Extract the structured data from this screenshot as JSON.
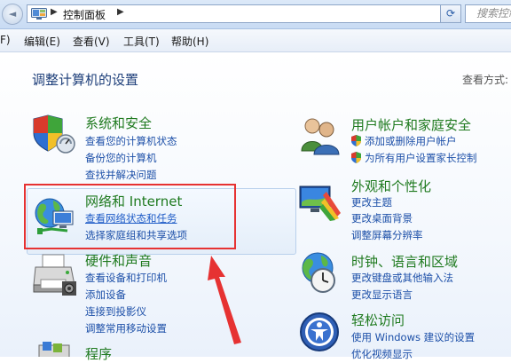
{
  "address_bar": {
    "back_glyph": "◄",
    "arrow_glyph": "▶",
    "crumb": "控制面板",
    "dropdown_glyph": "▾",
    "refresh_glyph": "⟳",
    "search_placeholder": "搜索控制面板"
  },
  "menu": {
    "items": [
      {
        "label": "F)"
      },
      {
        "label": "编辑(E)"
      },
      {
        "label": "查看(V)"
      },
      {
        "label": "工具(T)"
      },
      {
        "label": "帮助(H)"
      }
    ]
  },
  "main": {
    "title": "调整计算机的设置",
    "view_by_label": "查看方式:",
    "left_categories": [
      {
        "title": "系统和安全",
        "icon": "shield-icon",
        "links": [
          "查看您的计算机状态",
          "备份您的计算机",
          "查找并解决问题"
        ]
      },
      {
        "title": "网络和 Internet",
        "icon": "network-icon",
        "links": [
          "查看网络状态和任务",
          "选择家庭组和共享选项"
        ]
      },
      {
        "title": "硬件和声音",
        "icon": "printer-icon",
        "links": [
          "查看设备和打印机",
          "添加设备",
          "连接到投影仪",
          "调整常用移动设置"
        ]
      },
      {
        "title": "程序",
        "icon": "programs-icon",
        "links": []
      }
    ],
    "right_categories": [
      {
        "title": "用户帐户和家庭安全",
        "icon": "users-icon",
        "links": [
          "添加或删除用户帐户",
          "为所有用户设置家长控制"
        ]
      },
      {
        "title": "外观和个性化",
        "icon": "appearance-icon",
        "links": [
          "更改主题",
          "更改桌面背景",
          "调整屏幕分辨率"
        ]
      },
      {
        "title": "时钟、语言和区域",
        "icon": "globe-clock-icon",
        "links": [
          "更改键盘或其他输入法",
          "更改显示语言"
        ]
      },
      {
        "title": "轻松访问",
        "icon": "ease-of-access-icon",
        "links": [
          "使用 Windows 建议的设置",
          "优化视频显示"
        ]
      }
    ]
  },
  "annotation": {
    "frame_color": "#e63232",
    "arrow_color": "#e63232"
  }
}
